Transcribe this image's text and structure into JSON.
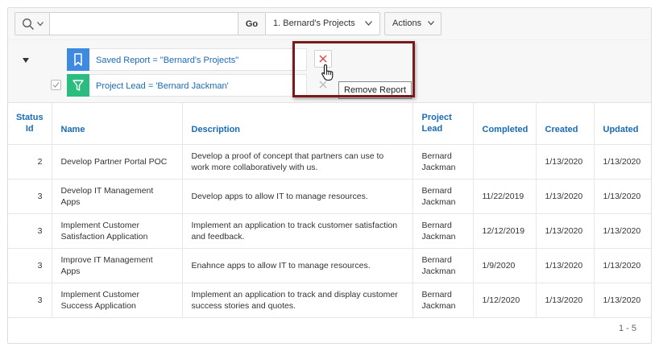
{
  "toolbar": {
    "search_value": "",
    "go_label": "Go",
    "report_selected": "1. Bernard's Projects",
    "actions_label": "Actions"
  },
  "filters": {
    "saved_report": "Saved Report = \"Bernard's Projects\"",
    "project_lead": "Project Lead = 'Bernard Jackman'",
    "tooltip": "Remove Report"
  },
  "table": {
    "headers": {
      "status_id": "Status Id",
      "name": "Name",
      "description": "Description",
      "project_lead": "Project Lead",
      "completed": "Completed",
      "created": "Created",
      "updated": "Updated"
    },
    "rows": [
      {
        "status_id": "2",
        "name": "Develop Partner Portal POC",
        "description": "Develop a proof of concept that partners can use to work more collaboratively with us.",
        "project_lead": "Bernard Jackman",
        "completed": "",
        "created": "1/13/2020",
        "updated": "1/13/2020"
      },
      {
        "status_id": "3",
        "name": "Develop IT Management Apps",
        "description": "Develop apps to allow IT to manage resources.",
        "project_lead": "Bernard Jackman",
        "completed": "11/22/2019",
        "created": "1/13/2020",
        "updated": "1/13/2020"
      },
      {
        "status_id": "3",
        "name": "Implement Customer Satisfaction Application",
        "description": "Implement an application to track customer satisfaction and feedback.",
        "project_lead": "Bernard Jackman",
        "completed": "12/12/2019",
        "created": "1/13/2020",
        "updated": "1/13/2020"
      },
      {
        "status_id": "3",
        "name": "Improve IT Management Apps",
        "description": "Enahnce apps to allow IT to manage resources.",
        "project_lead": "Bernard Jackman",
        "completed": "1/9/2020",
        "created": "1/13/2020",
        "updated": "1/13/2020"
      },
      {
        "status_id": "3",
        "name": "Implement Customer Success Application",
        "description": "Implement an application to track and display customer success stories and quotes.",
        "project_lead": "Bernard Jackman",
        "completed": "1/12/2020",
        "created": "1/13/2020",
        "updated": "1/13/2020"
      }
    ]
  },
  "pagination": "1 - 5",
  "colors": {
    "link": "#1a6ab5",
    "saved_report_icon": "#3e8ae0",
    "filter_icon": "#2bbc7f",
    "remove_x": "#e04040",
    "highlight_border": "#7b1a1a"
  },
  "icons": [
    "search-icon",
    "chevron-down-icon",
    "bookmark-icon",
    "filter-icon",
    "close-icon",
    "checkbox-icon",
    "hand-cursor-icon"
  ]
}
